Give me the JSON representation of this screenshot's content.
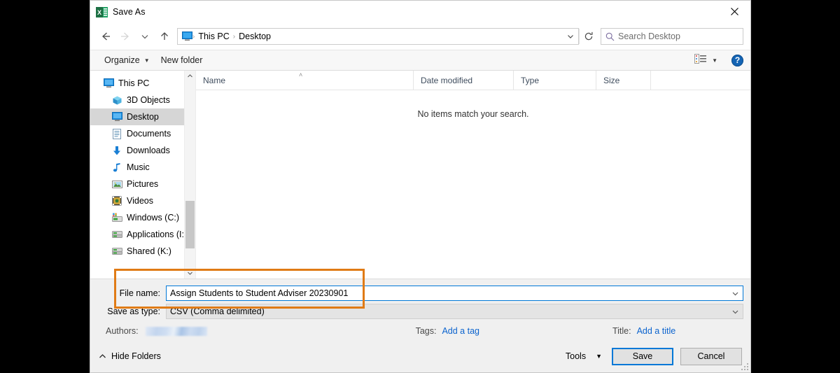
{
  "window": {
    "title": "Save As",
    "app_icon": "excel-icon",
    "close_label": "✕"
  },
  "nav": {
    "back_icon": "back-arrow-icon",
    "forward_icon": "forward-arrow-icon",
    "recent_icon": "recent-locations-icon",
    "up_icon": "up-arrow-icon",
    "address_icon": "this-pc-icon",
    "breadcrumbs": [
      "This PC",
      "Desktop"
    ],
    "separator": "›",
    "dropdown_icon": "chevron-down-icon",
    "refresh_icon": "refresh-icon",
    "search_placeholder": "Search Desktop",
    "search_icon": "search-icon"
  },
  "commandbar": {
    "organize_label": "Organize",
    "organize_caret": "▼",
    "new_folder_label": "New folder",
    "view_icon": "view-layout-icon",
    "view_caret": "▼",
    "help_label": "?"
  },
  "sidebar": {
    "items": [
      {
        "label": "This PC",
        "icon": "this-pc-icon",
        "indent": false,
        "selected": false
      },
      {
        "label": "3D Objects",
        "icon": "3d-objects-icon",
        "indent": true,
        "selected": false
      },
      {
        "label": "Desktop",
        "icon": "desktop-icon",
        "indent": true,
        "selected": true
      },
      {
        "label": "Documents",
        "icon": "documents-icon",
        "indent": true,
        "selected": false
      },
      {
        "label": "Downloads",
        "icon": "downloads-icon",
        "indent": true,
        "selected": false
      },
      {
        "label": "Music",
        "icon": "music-icon",
        "indent": true,
        "selected": false
      },
      {
        "label": "Pictures",
        "icon": "pictures-icon",
        "indent": true,
        "selected": false
      },
      {
        "label": "Videos",
        "icon": "videos-icon",
        "indent": true,
        "selected": false
      },
      {
        "label": "Windows (C:)",
        "icon": "local-disk-icon",
        "indent": true,
        "selected": false
      },
      {
        "label": "Applications (I:)",
        "icon": "network-drive-icon",
        "indent": true,
        "selected": false
      },
      {
        "label": "Shared (K:)",
        "icon": "network-drive-icon",
        "indent": true,
        "selected": false
      }
    ],
    "scroll_up_icon": "scroll-up-icon",
    "scroll_down_icon": "scroll-down-icon"
  },
  "filelist": {
    "columns": [
      "Name",
      "Date modified",
      "Type",
      "Size"
    ],
    "sort_caret": "˄",
    "empty_message": "No items match your search.",
    "rows": []
  },
  "form": {
    "file_name_label": "File name:",
    "file_name_value": "Assign Students to Student Adviser 20230901",
    "save_as_type_label": "Save as type:",
    "save_as_type_value": "CSV (Comma delimited)",
    "caret_icon": "chevron-down-icon",
    "highlight_color": "#e07b16"
  },
  "metadata": {
    "authors_label": "Authors:",
    "authors_value": "",
    "tags_label": "Tags:",
    "tags_link": "Add a tag",
    "title_label": "Title:",
    "title_link": "Add a title"
  },
  "footer": {
    "hide_folders_label": "Hide Folders",
    "hide_folders_icon": "chevron-up-icon",
    "tools_label": "Tools",
    "tools_caret": "▼",
    "save_label": "Save",
    "cancel_label": "Cancel",
    "resize_grip_icon": "resize-grip-icon"
  }
}
